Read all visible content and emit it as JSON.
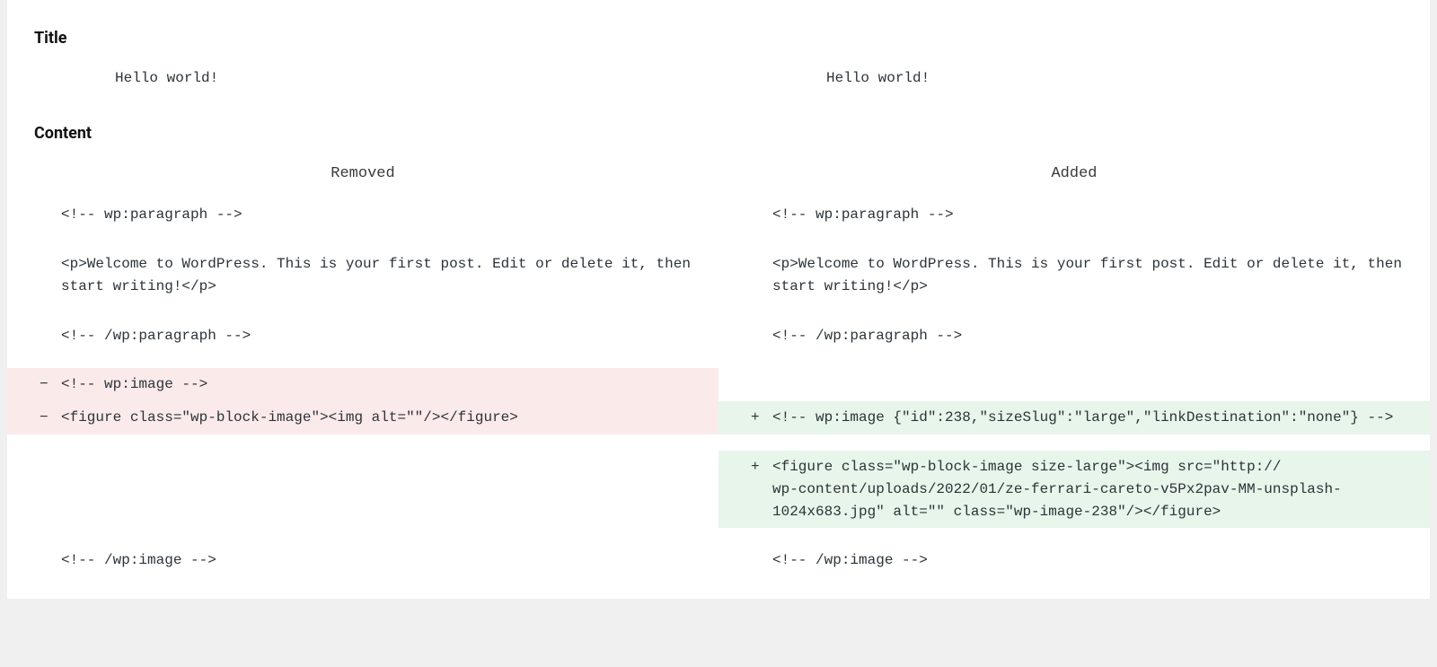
{
  "sections": {
    "title_heading": "Title",
    "content_heading": "Content"
  },
  "headers": {
    "removed": "Removed",
    "added": "Added"
  },
  "title_diff": {
    "left": "Hello world!",
    "right": "Hello world!"
  },
  "content_diff": [
    {
      "left": {
        "type": "ctx",
        "text": "<!-- wp:paragraph -->"
      },
      "right": {
        "type": "ctx",
        "text": "<!-- wp:paragraph -->"
      }
    },
    {
      "spacer": true
    },
    {
      "left": {
        "type": "ctx",
        "text": "<p>Welcome to WordPress. This is your first post. Edit or delete it, then start writing!</p>"
      },
      "right": {
        "type": "ctx",
        "text": "<p>Welcome to WordPress. This is your first post. Edit or delete it, then start writing!</p>"
      }
    },
    {
      "spacer": true
    },
    {
      "left": {
        "type": "ctx",
        "text": "<!-- /wp:paragraph -->"
      },
      "right": {
        "type": "ctx",
        "text": "<!-- /wp:paragraph -->"
      }
    },
    {
      "spacer": true
    },
    {
      "left": {
        "type": "del",
        "text": "<!-- wp:image -->"
      },
      "right": {
        "type": "empty"
      }
    },
    {
      "left": {
        "type": "del",
        "text": "<figure class=\"wp-block-image\"><img alt=\"\"/></figure>"
      },
      "right": {
        "type": "add",
        "text": "<!-- wp:image {\"id\":238,\"sizeSlug\":\"large\",\"linkDestination\":\"none\"} -->"
      }
    },
    {
      "spacer": true
    },
    {
      "left": {
        "type": "empty"
      },
      "right": {
        "type": "add",
        "text": "<figure class=\"wp-block-image size-large\"><img src=\"http://              wp-content/uploads/2022/01/ze-ferrari-careto-v5Px2pav-MM-unsplash-1024x683.jpg\" alt=\"\" class=\"wp-image-238\"/></figure>"
      }
    },
    {
      "spacer": true
    },
    {
      "left": {
        "type": "ctx",
        "text": "<!-- /wp:image -->"
      },
      "right": {
        "type": "ctx",
        "text": "<!-- /wp:image -->"
      }
    }
  ]
}
